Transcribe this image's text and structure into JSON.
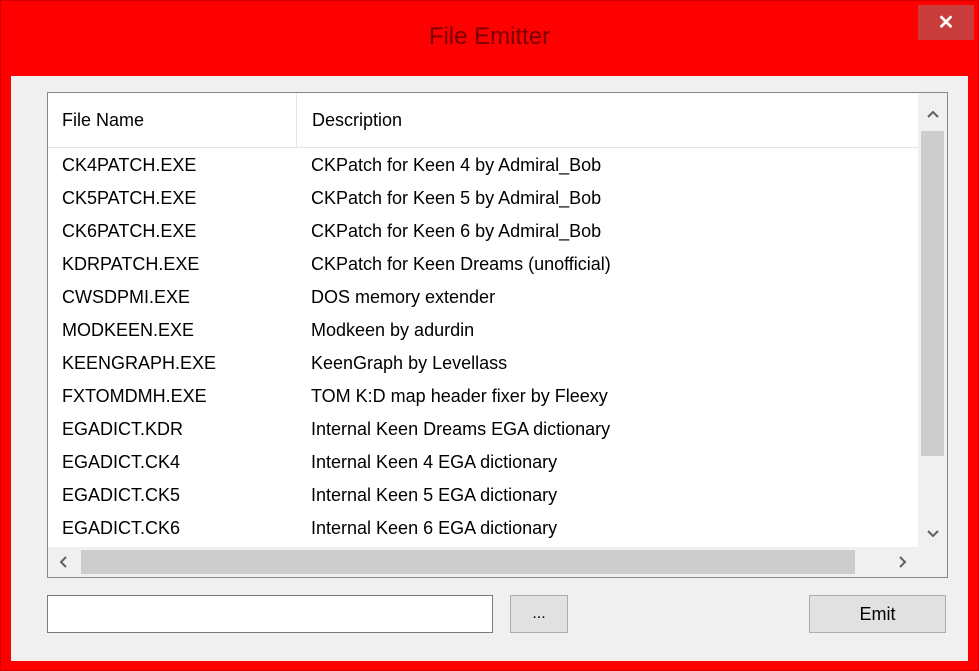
{
  "window": {
    "title": "File Emitter",
    "close_glyph": "✕",
    "colors": {
      "frame": "#ff0000",
      "title_text": "#7a0000",
      "close_button": "#c83c3c",
      "client": "#f0f0f0"
    }
  },
  "list": {
    "columns": [
      "File Name",
      "Description"
    ],
    "rows": [
      {
        "file": "CK4PATCH.EXE",
        "desc": "CKPatch for Keen 4 by Admiral_Bob"
      },
      {
        "file": "CK5PATCH.EXE",
        "desc": "CKPatch for Keen 5 by Admiral_Bob"
      },
      {
        "file": "CK6PATCH.EXE",
        "desc": "CKPatch for Keen 6 by Admiral_Bob"
      },
      {
        "file": "KDRPATCH.EXE",
        "desc": "CKPatch for Keen Dreams (unofficial)"
      },
      {
        "file": "CWSDPMI.EXE",
        "desc": "DOS memory extender"
      },
      {
        "file": "MODKEEN.EXE",
        "desc": "Modkeen by adurdin"
      },
      {
        "file": "KEENGRAPH.EXE",
        "desc": "KeenGraph by Levellass"
      },
      {
        "file": "FXTOMDMH.EXE",
        "desc": "TOM K:D map header fixer by Fleexy"
      },
      {
        "file": "EGADICT.KDR",
        "desc": "Internal Keen Dreams EGA dictionary"
      },
      {
        "file": "EGADICT.CK4",
        "desc": "Internal Keen 4 EGA dictionary"
      },
      {
        "file": "EGADICT.CK5",
        "desc": "Internal Keen 5 EGA dictionary"
      },
      {
        "file": "EGADICT.CK6",
        "desc": "Internal Keen 6 EGA dictionary"
      }
    ],
    "scroll": {
      "up_icon": "chevron-up-icon",
      "down_icon": "chevron-down-icon",
      "left_icon": "chevron-left-icon",
      "right_icon": "chevron-right-icon"
    }
  },
  "controls": {
    "path_value": "",
    "browse_label": "...",
    "emit_label": "Emit"
  }
}
